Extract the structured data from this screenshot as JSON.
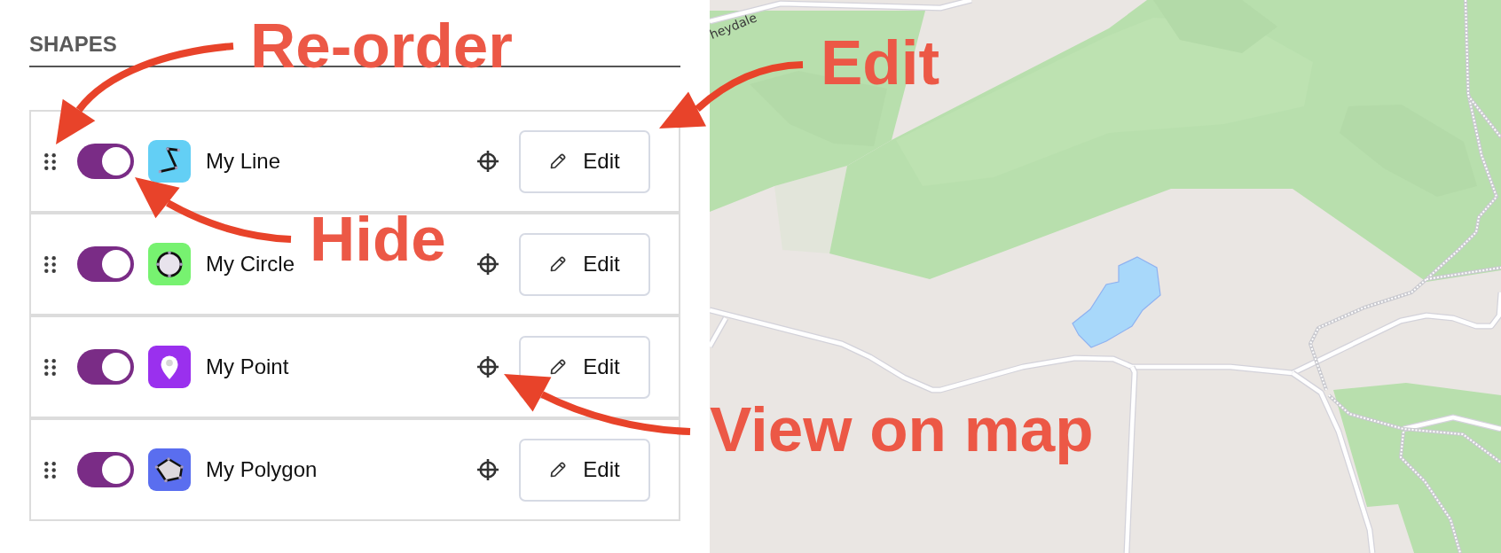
{
  "panel": {
    "title": "SHAPES"
  },
  "shapes": [
    {
      "name": "My Line",
      "kind": "line",
      "color": "#63cff5",
      "visible": true,
      "edit_label": "Edit"
    },
    {
      "name": "My Circle",
      "kind": "circle",
      "color": "#77f270",
      "visible": true,
      "edit_label": "Edit"
    },
    {
      "name": "My Point",
      "kind": "point",
      "color": "#9a30ee",
      "visible": true,
      "edit_label": "Edit"
    },
    {
      "name": "My Polygon",
      "kind": "polygon",
      "color": "#5a6eef",
      "visible": true,
      "edit_label": "Edit"
    }
  ],
  "map": {
    "place_label": "heydale"
  },
  "annotations": [
    {
      "label": "Re-order"
    },
    {
      "label": "Edit"
    },
    {
      "label": "Hide"
    },
    {
      "label": "View on map"
    }
  ]
}
